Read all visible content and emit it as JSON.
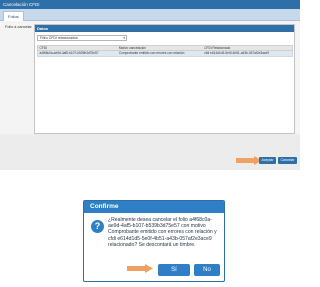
{
  "app": {
    "title": "Cancelación CFDI",
    "tab_label": "Folios"
  },
  "form": {
    "left_label": "Folio a cancelar"
  },
  "panel": {
    "header": "Datos",
    "filter_value": "Filtro CFDI relacionados"
  },
  "grid": {
    "columns": [
      "CFDI",
      "Motivo cancelación",
      "CFDI Relacionado"
    ],
    "rows": [
      [
        "a4f68c0a-ae9d-4af5-b107-b539b3d75e57",
        "Comprobante emitido con errores con relación",
        "cfdi e614d1d5-5e0f-4b51-a43b-057af2e3ace9"
      ]
    ]
  },
  "footnote": "Antes oprimir para afirm. los datos, verifica y selecciona los CFDI a cancelar",
  "buttons": {
    "accept": "Aceptar",
    "cancel": "Cancelar"
  },
  "dialog": {
    "title": "Confirme",
    "icon": "question-icon",
    "message": "¿Realmente desea cancelar el folio a4f68c0a-ae9d-4af5-b107-b539b3d75e57 con motivo Comprobante emitido con errores con relación y cfdi e614d1d5-5e0f-4b51-a43b-057af2e3ace9 relacionado? Se descontará un timbre.",
    "yes": "Sí",
    "no": "No"
  },
  "colors": {
    "primary": "#2f6fa7",
    "dialog_accent": "#2f7fc7",
    "arrow": "#f0a060"
  }
}
